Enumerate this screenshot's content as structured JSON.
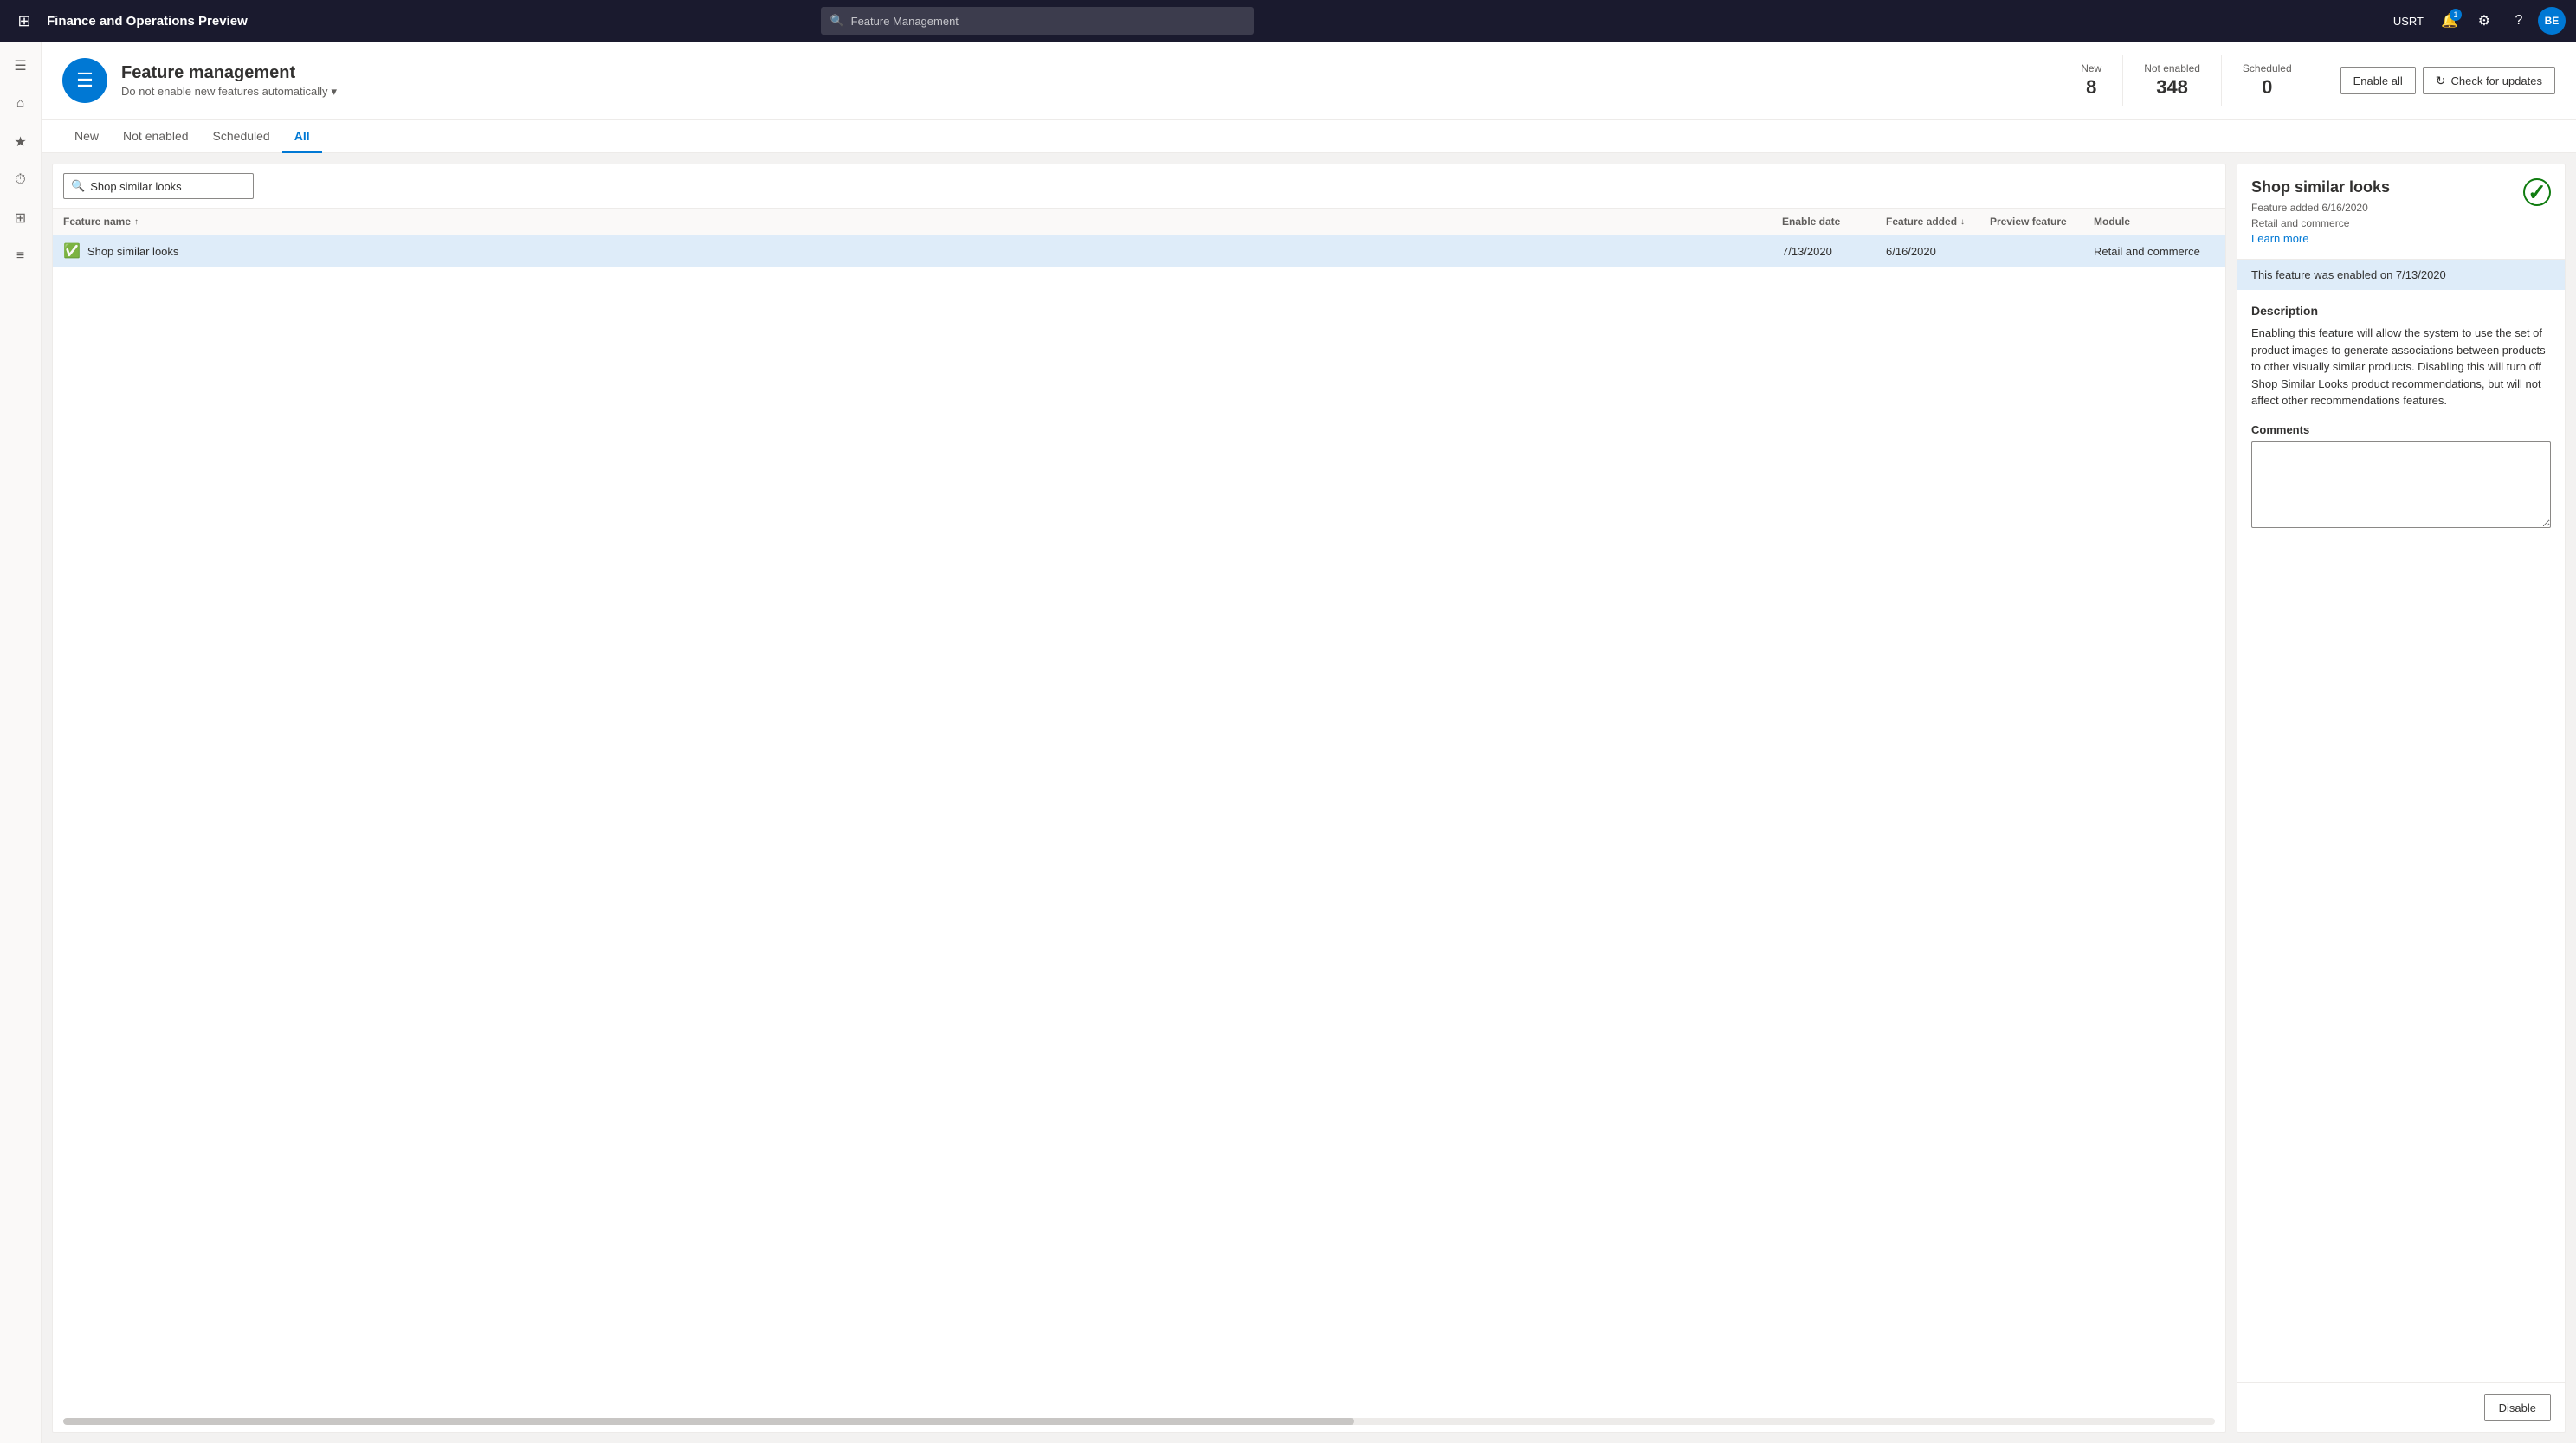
{
  "app": {
    "title": "Finance and Operations Preview",
    "search_placeholder": "Feature Management"
  },
  "topnav": {
    "user": "USRT",
    "avatar": "BE",
    "notification_count": "1",
    "icons": [
      "waffle",
      "bell",
      "settings",
      "help",
      "avatar"
    ]
  },
  "sidebar": {
    "items": [
      {
        "name": "menu-icon",
        "icon": "☰"
      },
      {
        "name": "home-icon",
        "icon": "⌂"
      },
      {
        "name": "favorites-icon",
        "icon": "★"
      },
      {
        "name": "recent-icon",
        "icon": "⏱"
      },
      {
        "name": "workspaces-icon",
        "icon": "⊞"
      },
      {
        "name": "modules-icon",
        "icon": "≡"
      }
    ]
  },
  "page": {
    "icon": "☰",
    "title": "Feature management",
    "subtitle": "Do not enable new features automatically",
    "stats": [
      {
        "label": "New",
        "value": "8"
      },
      {
        "label": "Not enabled",
        "value": "348"
      },
      {
        "label": "Scheduled",
        "value": "0"
      }
    ],
    "buttons": {
      "enable_all": "Enable all",
      "check_updates": "Check for updates"
    }
  },
  "tabs": [
    {
      "label": "New",
      "active": false
    },
    {
      "label": "Not enabled",
      "active": false
    },
    {
      "label": "Scheduled",
      "active": false
    },
    {
      "label": "All",
      "active": true
    }
  ],
  "table": {
    "search_placeholder": "Shop similar looks",
    "search_value": "Shop similar looks",
    "columns": [
      {
        "label": "Feature name",
        "sort": "asc"
      },
      {
        "label": "Enable date",
        "sort": null
      },
      {
        "label": "Feature added",
        "sort": "desc"
      },
      {
        "label": "Preview feature",
        "sort": null
      },
      {
        "label": "Module",
        "sort": null
      }
    ],
    "rows": [
      {
        "name": "Shop similar looks",
        "enabled": true,
        "enable_date": "7/13/2020",
        "feature_added": "6/16/2020",
        "preview_feature": "",
        "module": "Retail and commerce",
        "selected": true
      }
    ]
  },
  "detail": {
    "title": "Shop similar looks",
    "check_icon": "✓",
    "meta_added": "Feature added 6/16/2020",
    "meta_module": "Retail and commerce",
    "learn_more": "Learn more",
    "enabled_banner": "This feature was enabled on 7/13/2020",
    "description_label": "Description",
    "description": "Enabling this feature will allow the system to use the set of product images to generate associations between products to other visually similar products. Disabling this will turn off Shop Similar Looks product recommendations, but will not affect other recommendations features.",
    "comments_label": "Comments",
    "comments_placeholder": "",
    "disable_button": "Disable"
  }
}
